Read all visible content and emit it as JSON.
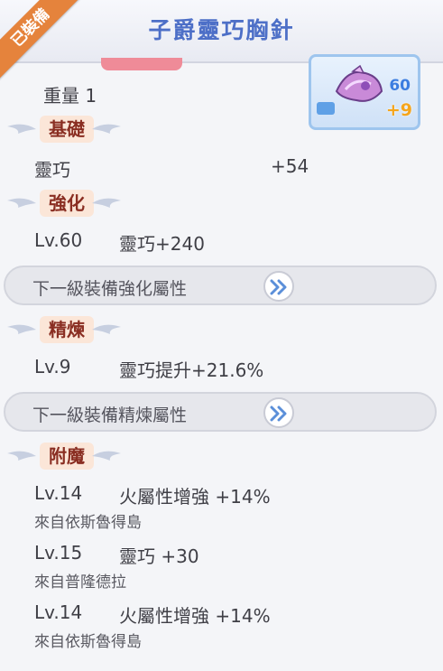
{
  "header": {
    "title": "子爵靈巧胸針",
    "equipped_ribbon": "已裝備"
  },
  "item": {
    "level": "60",
    "refine": "+9"
  },
  "weight": "重量 1",
  "sections": {
    "base": {
      "title": "基礎",
      "stat_name": "靈巧",
      "stat_value": "+54"
    },
    "enhance": {
      "title": "強化",
      "level": "Lv.60",
      "effect": "靈巧+240",
      "next_button": "下一級裝備強化屬性"
    },
    "refine": {
      "title": "精煉",
      "level": "Lv.9",
      "effect": "靈巧提升+21.6%",
      "next_button": "下一級裝備精煉屬性"
    },
    "enchant": {
      "title": "附魔",
      "entries": [
        {
          "level": "Lv.14",
          "effect": "火屬性增強 +14%",
          "source": "來自依斯魯得島"
        },
        {
          "level": "Lv.15",
          "effect": "靈巧 +30",
          "source": "來自普隆德拉"
        },
        {
          "level": "Lv.14",
          "effect": "火屬性增強 +14%",
          "source": "來自依斯魯得島"
        }
      ]
    }
  },
  "colors": {
    "title": "#4d6fc7",
    "ribbon": "#e5833c",
    "section_badge": "#fbe6d8",
    "refine_plus": "#f5a51c"
  },
  "icons": {
    "next": "double-chevron-right-icon",
    "wing": "wing-ornament-icon"
  }
}
